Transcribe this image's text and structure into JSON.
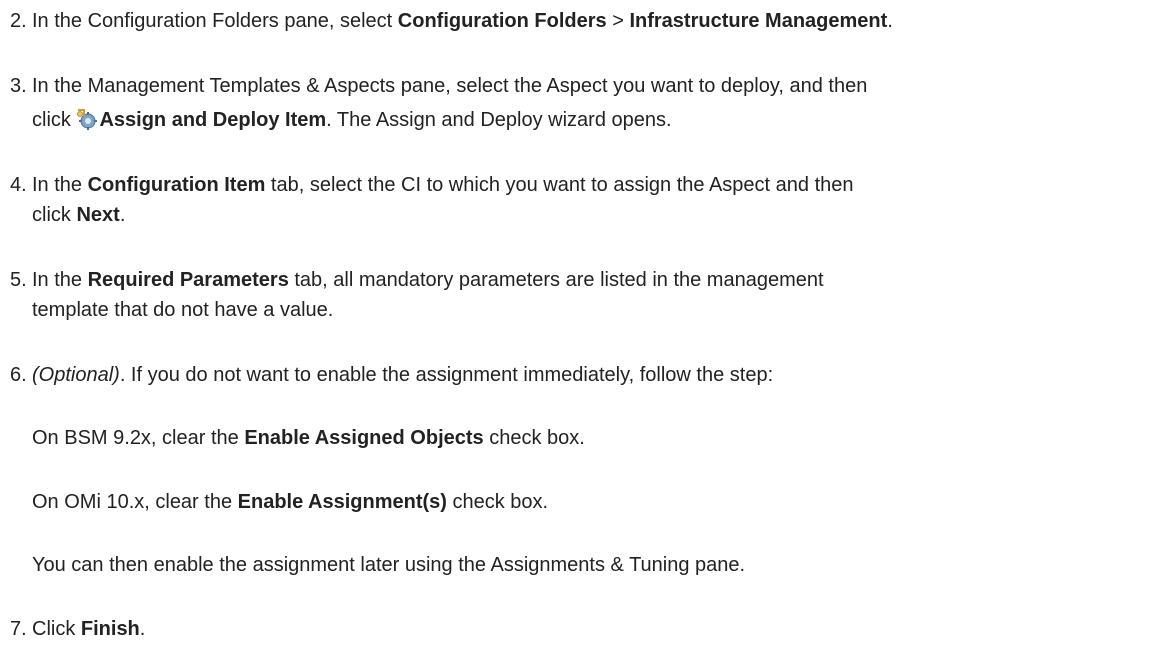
{
  "steps": {
    "s2": {
      "number": "2.",
      "t1": "In the Configuration Folders pane, select ",
      "b1": "Configuration Folders",
      "t2": " > ",
      "b2": "Infrastructure Management",
      "t3": "."
    },
    "s3": {
      "number": "3.",
      "line1": "In the Management Templates & Aspects pane, select the Aspect you want to deploy, and then",
      "t1": "click ",
      "icon": "assign-deploy-icon",
      "b1": "Assign and Deploy Item",
      "t2": ". The Assign and Deploy wizard opens."
    },
    "s4": {
      "number": "4.",
      "t1": "In the ",
      "b1": "Configuration Item",
      "t2": " tab, select the CI to which you want to assign the Aspect and then",
      "t3": "click ",
      "b2": "Next",
      "t4": "."
    },
    "s5": {
      "number": "5.",
      "t1": "In the ",
      "b1": "Required Parameters",
      "t2": " tab, all mandatory parameters are listed in the management",
      "line2": "template that do not have a value."
    },
    "s6": {
      "number": "6.",
      "i1": "(Optional)",
      "t1": ". If you do not want to enable the assignment immediately, follow the step:",
      "bsm_t1": "On BSM 9.2x, clear the ",
      "bsm_b1": "Enable Assigned Objects",
      "bsm_t2": " check box.",
      "omi_t1": "On OMi 10.x, clear the ",
      "omi_b1": "Enable Assignment(s)",
      "omi_t2": " check box.",
      "later": "You can then enable the assignment later using the Assignments & Tuning pane."
    },
    "s7": {
      "number": "7.",
      "t1": "Click ",
      "b1": "Finish",
      "t2": "."
    }
  }
}
